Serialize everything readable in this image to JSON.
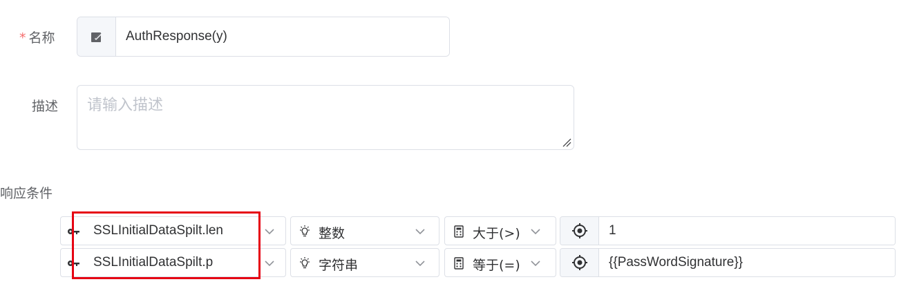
{
  "form": {
    "name_required_mark": "*",
    "name_label": "名称",
    "name_value": "AuthResponse(y)",
    "description_label": "描述",
    "description_placeholder": "请输入描述",
    "description_value": ""
  },
  "conditions": {
    "section_title": "响应条件",
    "rows": [
      {
        "field": "SSLInitialDataSpilt.len",
        "type": "整数",
        "operator": "大于(>)",
        "value": "1"
      },
      {
        "field": "SSLInitialDataSpilt.p",
        "type": "字符串",
        "operator": "等于(=)",
        "value": "{{PassWordSignature}}"
      }
    ]
  },
  "icons": {
    "name_prepend": "edit-icon",
    "field": "key-icon",
    "type": "lightbulb-icon",
    "operator": "calculator-icon",
    "value_prepend": "target-icon",
    "dropdown": "chevron-down-icon"
  },
  "colors": {
    "required": "#f56c6c",
    "highlight": "#e60012",
    "border": "#dcdfe6",
    "placeholder": "#c0c4cc"
  }
}
